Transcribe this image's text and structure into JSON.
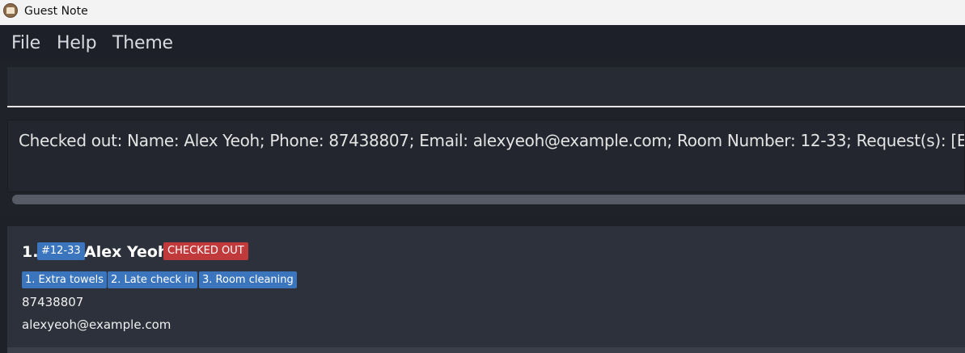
{
  "window": {
    "title": "Guest Note"
  },
  "menu": {
    "file": "File",
    "help": "Help",
    "theme": "Theme"
  },
  "command_box": {
    "value": ""
  },
  "result_display": {
    "text": "Checked out: Name: Alex Yeoh; Phone: 87438807; Email: alexyeoh@example.com; Room Number: 12-33; Request(s): [Extra towels"
  },
  "guests": [
    {
      "index": "1.",
      "room": "#12-33",
      "name": "Alex Yeoh",
      "status": "CHECKED OUT",
      "requests": [
        "1. Extra towels",
        "2. Late check in",
        "3. Room cleaning"
      ],
      "phone": "87438807",
      "email": "alexyeoh@example.com"
    }
  ],
  "colors": {
    "tag_blue": "#3a75bd",
    "status_red": "#c0393b",
    "background": "#2b2f38"
  }
}
